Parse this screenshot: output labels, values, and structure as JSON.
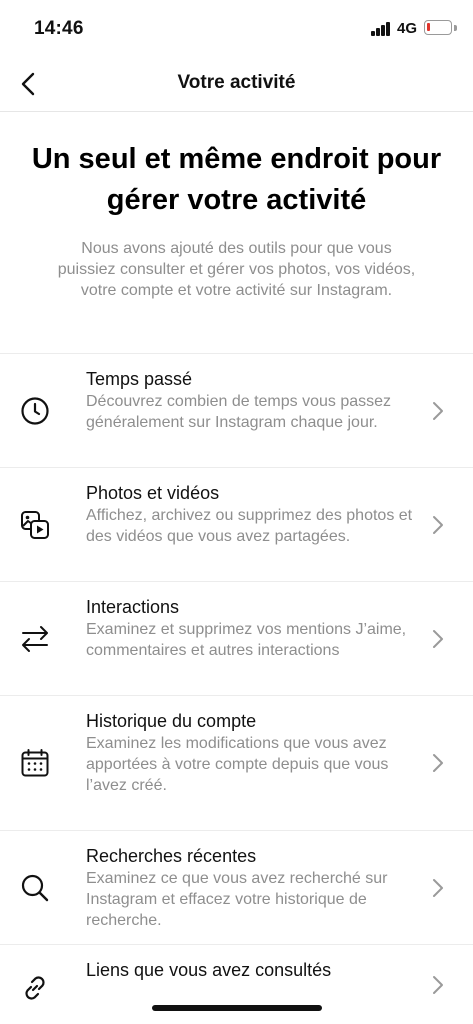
{
  "status_bar": {
    "time": "14:46",
    "network": "4G"
  },
  "nav": {
    "title": "Votre activité",
    "back_icon": "chevron-left-icon"
  },
  "hero": {
    "title": "Un seul et même endroit pour gérer votre activité",
    "description": "Nous avons ajouté des outils pour que vous puissiez consulter et gérer vos photos, vos vidéos, votre compte et votre activité sur Instagram."
  },
  "menu": {
    "items": [
      {
        "title": "Temps passé",
        "description": "Découvrez combien de temps vous passez généralement sur Instagram chaque jour.",
        "icon": "clock-icon"
      },
      {
        "title": "Photos et vidéos",
        "description": "Affichez, archivez ou supprimez des photos et des vidéos que vous avez partagées.",
        "icon": "photos-videos-icon"
      },
      {
        "title": "Interactions",
        "description": "Examinez et supprimez vos mentions J’aime, commentaires et autres interactions",
        "icon": "swap-arrows-icon"
      },
      {
        "title": "Historique du compte",
        "description": "Examinez les modifications que vous avez apportées à votre compte depuis que vous l’avez créé.",
        "icon": "calendar-icon"
      },
      {
        "title": "Recherches récentes",
        "description": "Examinez ce que vous avez recherché sur Instagram et effacez votre historique de recherche.",
        "icon": "search-icon"
      },
      {
        "title": "Liens que vous avez consultés",
        "description": "",
        "icon": "link-icon"
      }
    ]
  },
  "colors": {
    "text": "#111111",
    "secondary": "#8e8e8e",
    "divider": "#ececec",
    "battery_low": "#e0342c"
  }
}
